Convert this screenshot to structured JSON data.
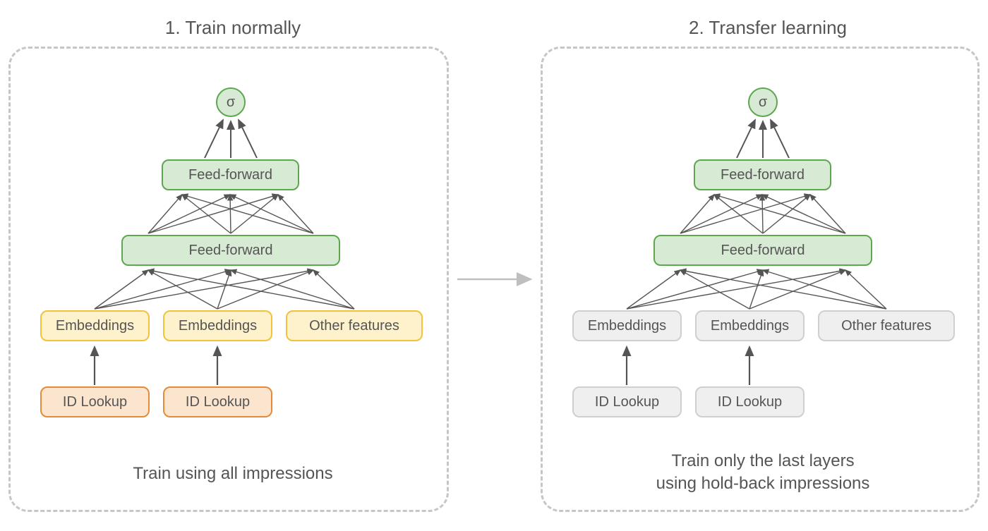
{
  "titles": {
    "left": "1. Train normally",
    "right": "2. Transfer learning"
  },
  "sigma": "σ",
  "labels": {
    "feedforward": "Feed-forward",
    "embeddings": "Embeddings",
    "other_features": "Other features",
    "id_lookup": "ID Lookup"
  },
  "captions": {
    "left": "Train using all impressions",
    "right_line1": "Train only the last layers",
    "right_line2": "using hold-back impressions"
  },
  "colors": {
    "green_fill": "#d7ead3",
    "green_stroke": "#5ea74f",
    "yellow_fill": "#fdf2cc",
    "yellow_stroke": "#efc33a",
    "orange_fill": "#fce5cf",
    "orange_stroke": "#e58a39",
    "gray_fill": "#efefef",
    "gray_stroke": "#cfcfcf",
    "arrow": "#555555",
    "transition_arrow": "#bfbfbf"
  },
  "diagram": {
    "left_panel": {
      "trainable": true,
      "layers": [
        {
          "type": "sigma"
        },
        {
          "type": "feedforward"
        },
        {
          "type": "feedforward"
        },
        {
          "type": "inputs",
          "blocks": [
            "Embeddings",
            "Embeddings",
            "Other features"
          ]
        },
        {
          "type": "lookup",
          "blocks": [
            "ID Lookup",
            "ID Lookup"
          ]
        }
      ]
    },
    "right_panel": {
      "trainable_layers": "top_only",
      "layers": [
        {
          "type": "sigma",
          "trainable": true
        },
        {
          "type": "feedforward",
          "trainable": true
        },
        {
          "type": "feedforward",
          "trainable": true
        },
        {
          "type": "inputs",
          "blocks": [
            "Embeddings",
            "Embeddings",
            "Other features"
          ],
          "trainable": false
        },
        {
          "type": "lookup",
          "blocks": [
            "ID Lookup",
            "ID Lookup"
          ],
          "trainable": false
        }
      ]
    }
  }
}
